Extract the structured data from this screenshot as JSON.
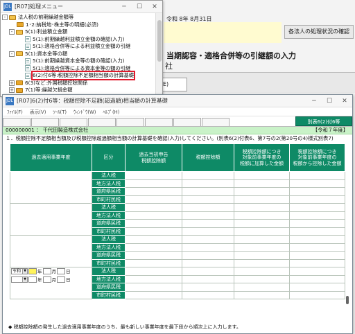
{
  "background": {
    "date_text": "令和 8年 8月31日",
    "status_button": "各法人の処理状況の確認",
    "heading": "当期認容・適格合併等の引継額の入力",
    "subheading": "社",
    "small_button": "E)"
  },
  "menu": {
    "title": "[R07]処理メニュー",
    "items": [
      {
        "label": "法人税の前期繰越金額等",
        "type": "folder",
        "expander": "-"
      },
      {
        "label": "1･2:納税地･株主等の明細(必須)",
        "type": "folder",
        "expander": ""
      },
      {
        "label": "5(1):利益積立金額",
        "type": "folder",
        "expander": "-"
      },
      {
        "label": "5(1):前期繰越利益積立金額の確認(入力)",
        "type": "leaf",
        "expander": ""
      },
      {
        "label": "5(1):適格合併等による利益積立金額の引継",
        "type": "leaf",
        "expander": ""
      },
      {
        "label": "5(1):資本金等の額",
        "type": "folder",
        "expander": "-"
      },
      {
        "label": "5(1):前期繰越資本金等の額の確認(入力)",
        "type": "leaf",
        "expander": ""
      },
      {
        "label": "5(1):適格合併等による資本金等の額の引継",
        "type": "leaf",
        "expander": ""
      },
      {
        "label": "6(2)付6等:税額控除不足額相当額の計算基礎",
        "type": "leaf",
        "expander": "",
        "highlight": true
      },
      {
        "label": "6(3)など:外国税額控除関係",
        "type": "folder",
        "expander": "+"
      },
      {
        "label": "7(1)等:繰越欠損金額",
        "type": "folder",
        "expander": "+"
      }
    ]
  },
  "form": {
    "title": "[R07]6(2)付6等：税額控除不足額(超過額)相当額の計算基礎",
    "menubar": [
      "ﾌｧｲﾙ(F)",
      "表示(V)",
      "ﾂｰﾙ(T)",
      "ｳｨﾝﾄﾞｳ(W)",
      "ﾍﾙﾌﾟ(H)"
    ],
    "active_tab": "別表6(2)付6等",
    "org_name": "000000001 ： 千代田製造株式会社",
    "era_badge": "【令和７年度】",
    "instruction": "１．税額控除不足額相当額及び税額控除超過額相当額の計算基礎を確認(入力)してください。(別表6(2)付表6、第7号の2(第20号の4)様式別表7)",
    "headers": [
      "過去適用事業年度",
      "区分",
      "過去当初申告\n税額控除額",
      "税額控除額",
      "税額控除額につき\n対象前事業年度の\n税額に加算した金額",
      "税額控除額につき\n対象前事業年度の\n税額から控除した金額"
    ],
    "categories": [
      "法人税",
      "地方法人税",
      "道府県民税",
      "市町村民税"
    ],
    "year_select": "令和",
    "year_label": "年",
    "month_label": "月",
    "day_label": "日",
    "footnote": "◆ 税額控除額の発生した過去適用事業年度のうち、最も新しい事業年度を最下段から順次上に入力します。"
  }
}
